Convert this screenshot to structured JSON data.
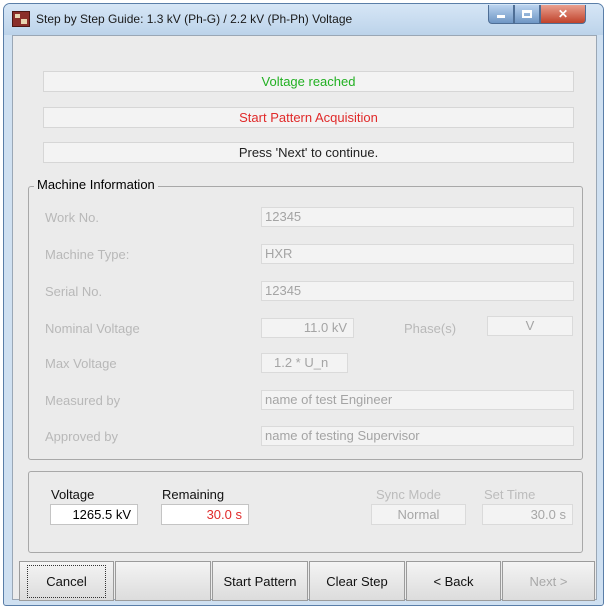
{
  "window": {
    "title": "Step by Step Guide: 1.3 kV (Ph-G) / 2.2 kV (Ph-Ph) Voltage"
  },
  "status": {
    "line1": "Voltage reached",
    "line2": "Start Pattern Acquisition",
    "line3": "Press 'Next' to continue."
  },
  "machine_info": {
    "legend": "Machine Information",
    "work_no_label": "Work No.",
    "work_no": "12345",
    "machine_type_label": "Machine Type:",
    "machine_type": "HXR",
    "serial_no_label": "Serial No.",
    "serial_no": "12345",
    "nominal_voltage_label": "Nominal Voltage",
    "nominal_voltage": "11.0 kV",
    "phase_label": "Phase(s)",
    "phase": "V",
    "max_voltage_label": "Max Voltage",
    "max_voltage": "1.2 * U_n",
    "measured_by_label": "Measured by",
    "measured_by": "name of test Engineer",
    "approved_by_label": "Approved by",
    "approved_by": "name of testing Supervisor"
  },
  "readout": {
    "voltage_label": "Voltage",
    "voltage": "1265.5 kV",
    "remaining_label": "Remaining",
    "remaining": "30.0  s",
    "sync_mode_label": "Sync Mode",
    "sync_mode": "Normal",
    "set_time_label": "Set Time",
    "set_time": "30.0  s"
  },
  "buttons": {
    "cancel": "Cancel",
    "start_pattern": "Start Pattern",
    "clear_step": "Clear Step",
    "back": "< Back",
    "next": "Next >"
  }
}
